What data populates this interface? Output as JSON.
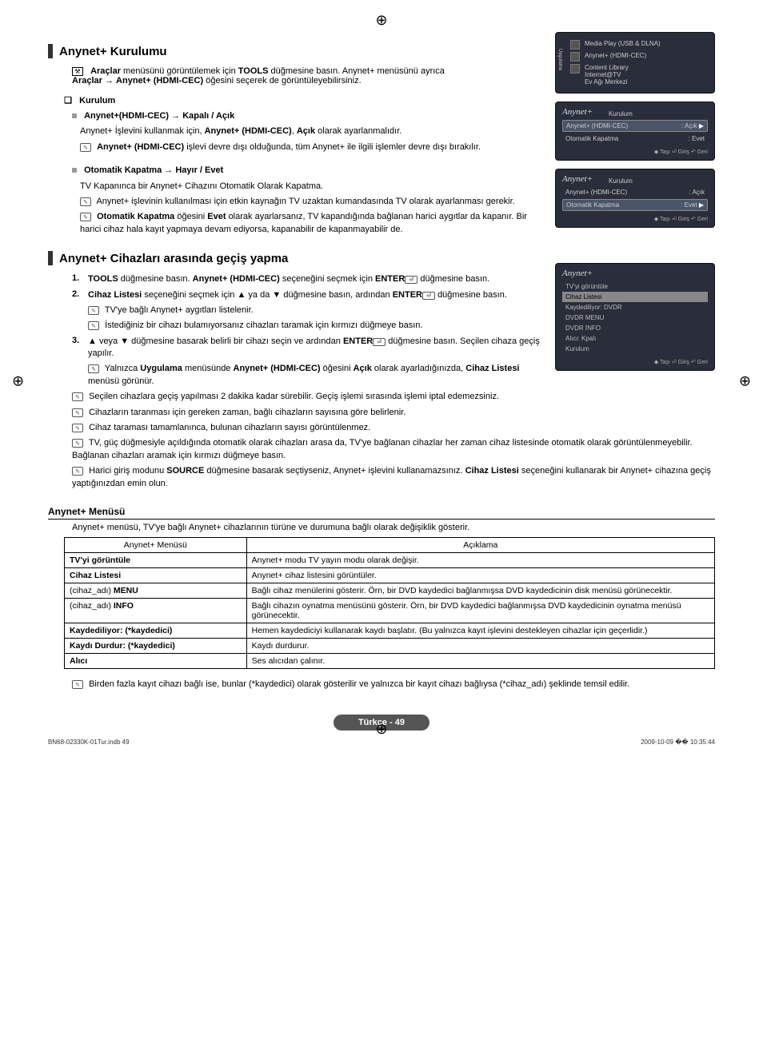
{
  "reg_mark": "⊕",
  "section1": {
    "title": "Anynet+ Kurulumu",
    "intro": "menüsünü görüntülemek için",
    "intro_bold_tools": "TOOLS",
    "intro_bold_araclar": "Araçlar",
    "intro_tail": "düğmesine basın. Anynet+ menüsünü ayrıca",
    "intro_line2_a": "Araçlar",
    "intro_line2_b": "Anynet+ (HDMI-CEC)",
    "intro_line2_c": "öğesini seçerek de görüntüleyebilirsiniz.",
    "subsec_kurulum": "Kurulum",
    "item1_title": "Anynet+(HDMI-CEC) → Kapalı / Açık",
    "item1_p1a": "Anynet+ İşlevini kullanmak için,",
    "item1_p1b": "Anynet+ (HDMI-CEC)",
    "item1_p1c": "Açık",
    "item1_p1d": "olarak ayarlanmalıdır.",
    "item1_note_a": "Anynet+ (HDMI-CEC)",
    "item1_note_b": "işlevi devre dışı olduğunda, tüm Anynet+ ile ilgili işlemler devre dışı bırakılır.",
    "item2_title": "Otomatik Kapatma → Hayır / Evet",
    "item2_p1": "TV Kapanınca bir Anynet+ Cihazını Otomatik Olarak Kapatma.",
    "item2_note1": "Anynet+ işlevinin kullanılması için etkin kaynağın TV uzaktan kumandasında TV olarak ayarlanması gerekir.",
    "item2_note2_a": "Otomatik Kapatma",
    "item2_note2_b": "Evet",
    "item2_note2_c": "olarak ayarlarsanız, TV kapandığında bağlanan harici aygıtlar da kapanır. Bir harici cihaz hala kayıt yapmaya devam ediyorsa, kapanabilir de kapanmayabilir de."
  },
  "section2": {
    "title": "Anynet+ Cihazları arasında geçiş yapma",
    "step1_a": "TOOLS",
    "step1_b": "düğmesine basın.",
    "step1_c": "Anynet+ (HDMI-CEC)",
    "step1_d": "seçeneğini seçmek için",
    "step1_e": "ENTER",
    "step1_f": "düğmesine basın.",
    "step2_a": "Cihaz Listesi",
    "step2_b": "seçeneğini seçmek için ▲ ya da ▼ düğmesine basın, ardından",
    "step2_c": "ENTER",
    "step2_d": "düğmesine basın.",
    "step2_note1": "TV'ye bağlı Anynet+ aygıtları listelenir.",
    "step2_note2": "İstediğiniz bir cihazı bulamıyorsanız cihazları taramak için kırmızı düğmeye basın.",
    "step3_a": "▲ veya ▼  düğmesine basarak belirli bir cihazı seçin ve ardından",
    "step3_b": "ENTER",
    "step3_c": "düğmesine basın. Seçilen cihaza geçiş yapılır.",
    "step3_note_a": "Yalnızca",
    "step3_note_b": "Uygulama",
    "step3_note_c": "menüsünde",
    "step3_note_d": "Anynet+ (HDMI-CEC)",
    "step3_note_e": "öğesini",
    "step3_note_f": "Açık",
    "step3_note_g": "olarak ayarladığınızda,",
    "step3_note_h": "Cihaz Listesi",
    "step3_note_i": "menüsü görünür.",
    "extra_note1": "Seçilen cihazlara geçiş yapılması 2 dakika kadar sürebilir. Geçiş işlemi sırasında işlemi iptal edemezsiniz.",
    "extra_note2": "Cihazların taranması için gereken zaman, bağlı cihazların sayısına göre belirlenir.",
    "extra_note3": "Cihaz taraması tamamlanınca, bulunan cihazların sayısı görüntülenmez.",
    "extra_note4": "TV, güç düğmesiyle açıldığında otomatik olarak cihazları arasa da, TV'ye bağlanan cihazlar her zaman cihaz listesinde otomatik olarak görüntülenmeyebilir. Bağlanan cihazları aramak için kırmızı düğmeye basın.",
    "extra_note5_a": "Harici giriş modunu",
    "extra_note5_b": "SOURCE",
    "extra_note5_c": "düğmesine basarak seçtiyseniz, Anynet+ işlevini kullanamazsınız.",
    "extra_note5_d": "Cihaz Listesi",
    "extra_note5_e": "seçeneğini kullanarak bir Anynet+ cihazına geçiş yaptığınızdan emin olun."
  },
  "menu": {
    "heading": "Anynet+ Menüsü",
    "intro": "Anynet+ menüsü, TV'ye bağlı Anynet+ cihazlarının türüne ve durumuna bağlı olarak değişiklik gösterir.",
    "th1": "Anynet+ Menüsü",
    "th2": "Açıklama",
    "rows": [
      {
        "c1": "TV'yi görüntüle",
        "c2": "Anynet+ modu TV yayın modu olarak değişir.",
        "bold": true
      },
      {
        "c1": "Cihaz Listesi",
        "c2": "Anynet+ cihaz listesini görüntüler.",
        "bold": true
      },
      {
        "c1": "(cihaz_adı) MENU",
        "c2": "Bağlı cihaz menülerini gösterir. Örn, bir DVD kaydedici bağlanmışsa DVD kaydedicinin disk menüsü görünecektir."
      },
      {
        "c1": "(cihaz_adı) INFO",
        "c2": "Bağlı cihazın oynatma menüsünü gösterir. Örn, bir DVD kaydedici bağlanmışsa DVD kaydedicinin oynatma menüsü görünecektir."
      },
      {
        "c1": "Kaydediliyor: (*kaydedici)",
        "c2": "Hemen kaydediciyi kullanarak kaydı başlatır. (Bu yalnızca kayıt işlevini destekleyen cihazlar için geçerlidir.)",
        "bold": true
      },
      {
        "c1": "Kaydı Durdur: (*kaydedici)",
        "c2": "Kaydı durdurur.",
        "bold": true
      },
      {
        "c1": "Alıcı",
        "c2": "Ses alıcıdan çalınır.",
        "bold": true
      }
    ],
    "footnote": "Birden fazla kayıt cihazı bağlı ise, bunlar (*kaydedici) olarak gösterilir ve yalnızca bir kayıt cihazı bağlıysa (*cihaz_adı) şeklinde temsil edilir."
  },
  "osd1": {
    "side": "Uygulama",
    "r1": "Media Play (USB & DLNA)",
    "r2": "Anynet+ (HDMI-CEC)",
    "r3a": "Content Library",
    "r3b": "Internet@TV",
    "r3c": "Ev Ağı Merkezi"
  },
  "osd2": {
    "brand": "Anynet+",
    "title": "Kurulum",
    "r1a": "Anynet+ (HDMI-CEC)",
    "r1b": ": Açık",
    "r2a": "Otomatik Kapatma",
    "r2b": ": Evet",
    "footer": "◆ Taşı   ⏎ Giriş   ↶ Geri"
  },
  "osd3": {
    "brand": "Anynet+",
    "title": "Kurulum",
    "r1a": "Anynet+ (HDMI-CEC)",
    "r1b": ": Açık",
    "r2a": "Otomatik Kapatma",
    "r2b": ": Evet",
    "footer": "◆ Taşı   ⏎ Giriş   ↶ Geri"
  },
  "osd4": {
    "brand": "Anynet+",
    "i1": "TV'yi görüntüle",
    "i2": "Cihaz Listesi",
    "i3": "Kaydediliyor: DVDR",
    "i4": "DVDR MENU",
    "i5": "DVDR INFO",
    "i6": "Alıcı: Kpalı",
    "i7": "Kurulum",
    "footer": "◆ Taşı   ⏎ Giriş   ↶ Geri"
  },
  "footer": {
    "page": "Türkçe - 49",
    "left": "BN68-02330K-01Tur.indb   49",
    "right": "2009-10-09   �� 10:35:44"
  }
}
